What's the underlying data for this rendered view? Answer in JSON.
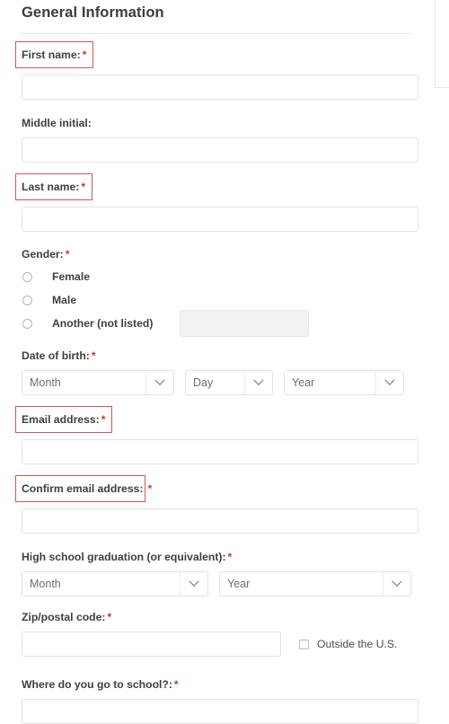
{
  "header": {
    "title": "General Information"
  },
  "required_marker": "*",
  "colors": {
    "highlight_outline": "#d9534f",
    "required_asterisk": "#c0392b",
    "input_border": "#e2e2e2",
    "divider": "#e7e7e7",
    "disabled_input_bg": "#f2f2f2"
  },
  "fields": {
    "first_name": {
      "label": "First name:",
      "required": true,
      "highlighted": true,
      "value": "",
      "placeholder": ""
    },
    "middle_initial": {
      "label": "Middle initial:",
      "required": false,
      "highlighted": false,
      "value": "",
      "placeholder": ""
    },
    "last_name": {
      "label": "Last name:",
      "required": true,
      "highlighted": true,
      "value": "",
      "placeholder": ""
    },
    "gender": {
      "label": "Gender:",
      "required": true,
      "highlighted": false,
      "options": [
        {
          "label": "Female",
          "selected": false
        },
        {
          "label": "Male",
          "selected": false
        },
        {
          "label": "Another (not listed)",
          "selected": false
        }
      ],
      "other_input": {
        "value": "",
        "placeholder": "",
        "disabled": true
      }
    },
    "date_of_birth": {
      "label": "Date of birth:",
      "required": true,
      "highlighted": false,
      "selects": [
        {
          "name": "month",
          "value": "Month"
        },
        {
          "name": "day",
          "value": "Day"
        },
        {
          "name": "year",
          "value": "Year"
        }
      ]
    },
    "email": {
      "label": "Email address:",
      "required": true,
      "highlighted": true,
      "value": "",
      "placeholder": ""
    },
    "confirm_email": {
      "label": "Confirm email address:",
      "required": true,
      "highlighted": true,
      "value": "",
      "placeholder": ""
    },
    "high_school_graduation": {
      "label": "High school graduation (or equivalent):",
      "required": true,
      "highlighted": false,
      "selects": [
        {
          "name": "month",
          "value": "Month"
        },
        {
          "name": "year",
          "value": "Year"
        }
      ]
    },
    "zip_code": {
      "label": "Zip/postal code:",
      "required": true,
      "highlighted": false,
      "value": "",
      "placeholder": "",
      "outside_us": {
        "label": "Outside the U.S.",
        "checked": false
      }
    },
    "school": {
      "label": "Where do you go to school?:",
      "required": true,
      "highlighted": false,
      "value": "",
      "placeholder": ""
    }
  }
}
